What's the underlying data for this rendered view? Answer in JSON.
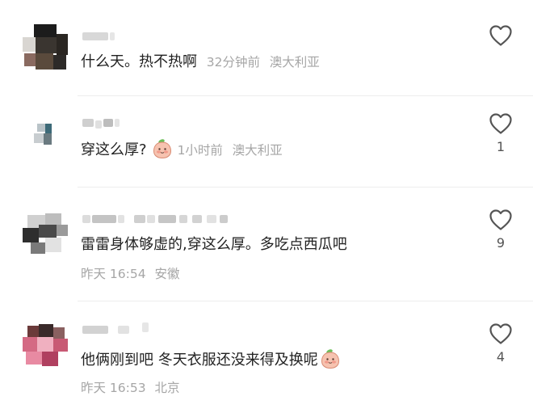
{
  "comments": [
    {
      "text": "什么天。热不热啊",
      "time": "32分钟前",
      "location": "澳大利亚",
      "like_count": "",
      "has_sticker": false
    },
    {
      "text": "穿这么厚?",
      "time": "1小时前",
      "location": "澳大利亚",
      "like_count": "1",
      "has_sticker": true,
      "sticker_icon": "peach-face-sticker"
    },
    {
      "text": "雷雷身体够虚的,穿这么厚。多吃点西瓜吧",
      "time": "昨天 16:54",
      "location": "安徽",
      "like_count": "9",
      "has_sticker": false
    },
    {
      "text": "他俩刚到吧 冬天衣服还没来得及换呢",
      "time": "昨天 16:53",
      "location": "北京",
      "like_count": "4",
      "has_sticker": true,
      "sticker_icon": "peach-face-sticker"
    }
  ],
  "icons": {
    "like": "heart-outline-icon",
    "avatar": "blurred-avatar"
  },
  "colors": {
    "text": "#222222",
    "meta": "#a6a6a6",
    "like_icon": "#555555",
    "divider": "#ededed",
    "background": "#ffffff"
  }
}
